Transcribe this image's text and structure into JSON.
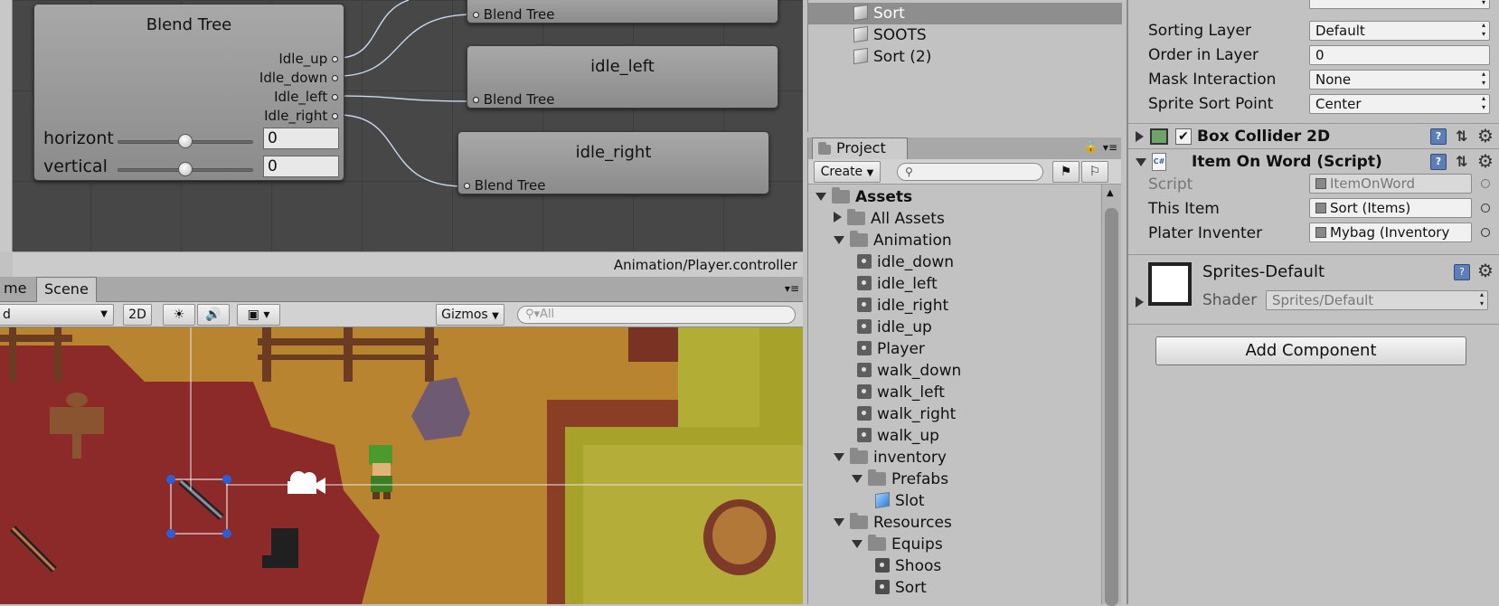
{
  "animator": {
    "blend_tree_node": {
      "title": "Blend Tree",
      "outputs": [
        "Idle_up",
        "Idle_down",
        "Idle_left",
        "Idle_right"
      ],
      "params": [
        {
          "name": "horizont",
          "value": "0",
          "slider_fraction": 0.5
        },
        {
          "name": "vertical",
          "value": "0",
          "slider_fraction": 0.5
        }
      ]
    },
    "motion_nodes": [
      {
        "title": "",
        "port_label": "Blend Tree"
      },
      {
        "title": "idle_left",
        "port_label": "Blend Tree"
      },
      {
        "title": "idle_right",
        "port_label": "Blend Tree"
      }
    ],
    "footer_path": "Animation/Player.controller"
  },
  "scene": {
    "tabs": [
      "me",
      "Scene"
    ],
    "shading_mode": "d",
    "toggle_2d": "2D",
    "gizmos_label": "Gizmos",
    "search_placeholder": "All"
  },
  "hierarchy": {
    "items": [
      {
        "label": "Sort",
        "selected": true
      },
      {
        "label": "SOOTS",
        "selected": false
      },
      {
        "label": "Sort (2)",
        "selected": false
      }
    ]
  },
  "project": {
    "tab_label": "Project",
    "create_label": "Create",
    "tree": [
      {
        "label": "Assets",
        "depth": 0,
        "kind": "folder",
        "expand": "open",
        "bold": true
      },
      {
        "label": "All Assets",
        "depth": 1,
        "kind": "folder",
        "expand": "closed"
      },
      {
        "label": "Animation",
        "depth": 1,
        "kind": "folder",
        "expand": "open"
      },
      {
        "label": "idle_down",
        "depth": 2,
        "kind": "anim"
      },
      {
        "label": "idle_left",
        "depth": 2,
        "kind": "anim"
      },
      {
        "label": "idle_right",
        "depth": 2,
        "kind": "anim"
      },
      {
        "label": "idle_up",
        "depth": 2,
        "kind": "anim"
      },
      {
        "label": "Player",
        "depth": 2,
        "kind": "controller"
      },
      {
        "label": "walk_down",
        "depth": 2,
        "kind": "anim"
      },
      {
        "label": "walk_left",
        "depth": 2,
        "kind": "anim"
      },
      {
        "label": "walk_right",
        "depth": 2,
        "kind": "anim"
      },
      {
        "label": "walk_up",
        "depth": 2,
        "kind": "anim"
      },
      {
        "label": "inventory",
        "depth": 1,
        "kind": "folder",
        "expand": "open"
      },
      {
        "label": "Prefabs",
        "depth": 2,
        "kind": "folder",
        "expand": "open"
      },
      {
        "label": "Slot",
        "depth": 3,
        "kind": "prefab"
      },
      {
        "label": "Resources",
        "depth": 1,
        "kind": "folder",
        "expand": "open"
      },
      {
        "label": "Equips",
        "depth": 2,
        "kind": "folder",
        "expand": "open"
      },
      {
        "label": "Shoos",
        "depth": 3,
        "kind": "asset"
      },
      {
        "label": "Sort",
        "depth": 3,
        "kind": "asset"
      }
    ]
  },
  "inspector": {
    "sprite_renderer": {
      "rows": [
        {
          "label": "Sorting Layer",
          "value": "Default",
          "dropdown": true
        },
        {
          "label": "Order in Layer",
          "value": "0",
          "dropdown": false
        },
        {
          "label": "Mask Interaction",
          "value": "None",
          "dropdown": true
        },
        {
          "label": "Sprite Sort Point",
          "value": "Center",
          "dropdown": true
        }
      ]
    },
    "box_collider": {
      "title": "Box Collider 2D",
      "enabled": true
    },
    "script_component": {
      "title": "Item On Word (Script)",
      "rows": [
        {
          "label": "Script",
          "value": "ItemOnWord",
          "disabled": true
        },
        {
          "label": "This Item",
          "value": "Sort (Items)",
          "disabled": false
        },
        {
          "label": "Plater Inventer",
          "value": "Mybag (Inventory",
          "disabled": false
        }
      ]
    },
    "material": {
      "name": "Sprites-Default",
      "shader_label": "Shader",
      "shader_value": "Sprites/Default"
    },
    "add_component_label": "Add Component",
    "colors": {
      "selection": "#8e8e8e",
      "panel": "#c2c2c2",
      "graph_bg": "#474747"
    }
  }
}
